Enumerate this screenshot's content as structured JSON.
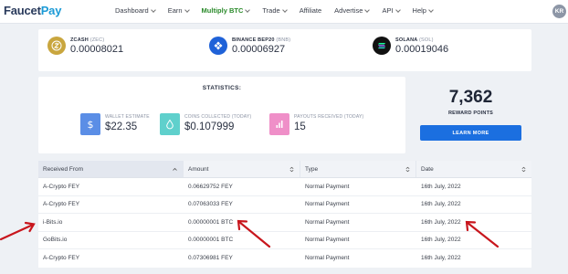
{
  "nav": {
    "logo_a": "Faucet",
    "logo_b": "Pay",
    "items": [
      {
        "label": "Dashboard",
        "dropdown": true,
        "active": false
      },
      {
        "label": "Earn",
        "dropdown": true,
        "active": false
      },
      {
        "label": "Multiply BTC",
        "dropdown": true,
        "active": true
      },
      {
        "label": "Trade",
        "dropdown": true,
        "active": false
      },
      {
        "label": "Affiliate",
        "dropdown": false,
        "active": false
      },
      {
        "label": "Advertise",
        "dropdown": true,
        "active": false
      },
      {
        "label": "API",
        "dropdown": true,
        "active": false
      },
      {
        "label": "Help",
        "dropdown": true,
        "active": false
      }
    ],
    "avatar": "KR"
  },
  "balances": [
    {
      "name": "ZCASH",
      "ticker": "(ZEC)",
      "value": "0.00008021",
      "color": "#c9a63e",
      "icon": "zcash-icon"
    },
    {
      "name": "BINANCE BEP20",
      "ticker": "(BNB)",
      "value": "0.00006927",
      "color": "#1f62d8",
      "icon": "binance-icon"
    },
    {
      "name": "SOLANA",
      "ticker": "(SOL)",
      "value": "0.00019046",
      "color": "#111111",
      "icon": "solana-icon"
    }
  ],
  "stats": {
    "title": "STATISTICS:",
    "items": [
      {
        "label": "WALLET ESTIMATE",
        "value": "$22.35",
        "color": "#5b8ee6",
        "icon": "dollar-icon"
      },
      {
        "label": "COINS COLLECTED (TODAY)",
        "value": "$0.107999",
        "color": "#5fd0cc",
        "icon": "drop-icon"
      },
      {
        "label": "PAYOUTS RECEIVED (TODAY)",
        "value": "15",
        "color": "#ef8fc8",
        "icon": "bar-chart-icon"
      }
    ]
  },
  "reward": {
    "value": "7,362",
    "label": "REWARD POINTS",
    "button": "LEARN MORE"
  },
  "table": {
    "headers": [
      "Received From",
      "Amount",
      "Type",
      "Date"
    ],
    "rows": [
      [
        "A-Crypto FEY",
        "0.06629752 FEY",
        "Normal Payment",
        "16th July, 2022"
      ],
      [
        "A-Crypto FEY",
        "0.07063033 FEY",
        "Normal Payment",
        "16th July, 2022"
      ],
      [
        "i-Bits.io",
        "0.00000001 BTC",
        "Normal Payment",
        "16th July, 2022"
      ],
      [
        "GoBits.io",
        "0.00000001 BTC",
        "Normal Payment",
        "16th July, 2022"
      ],
      [
        "A-Crypto FEY",
        "0.07306981 FEY",
        "Normal Payment",
        "16th July, 2022"
      ]
    ]
  },
  "colors": {
    "accent": "#1b6fe0",
    "annotation_arrow": "#c8161d",
    "active_nav": "#2a8a2a"
  }
}
